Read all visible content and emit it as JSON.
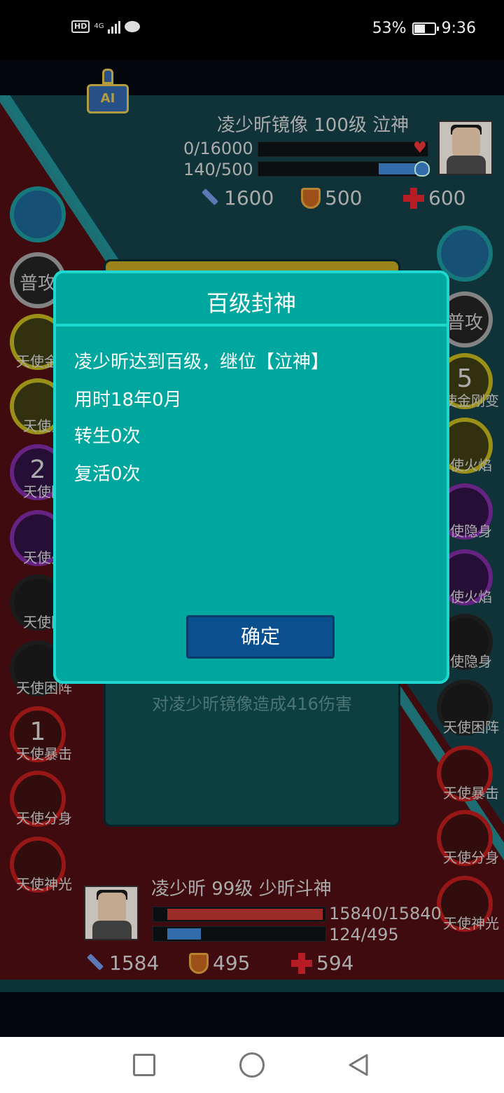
{
  "status_bar": {
    "hd": "HD",
    "network": "4G",
    "battery": "53%",
    "time": "9:36"
  },
  "ai_button": {
    "label": "AI"
  },
  "enemy": {
    "title": "凌少昕镜像 100级 泣神",
    "hp_text": "0/16000",
    "mp_text": "140/500",
    "hp_fraction": 0.0,
    "mp_fraction": 0.28,
    "attack": "1600",
    "defense": "500",
    "health": "600"
  },
  "player": {
    "title": "凌少昕 99级 少昕斗神",
    "hp_text": "15840/15840",
    "mp_text": "124/495",
    "hp_fraction": 1.0,
    "mp_fraction": 0.25,
    "attack": "1584",
    "defense": "495",
    "health": "594"
  },
  "left_skills": {
    "normal": "普攻",
    "s1": "天使金刚",
    "s2": "天使火",
    "s3_count": "2",
    "s3": "天使隐",
    "s4": "天使火",
    "s5": "天使隐",
    "s6": "天使困阵",
    "s7_count": "1",
    "s7": "天使暴击",
    "s8": "天使分身",
    "s9": "天使神光"
  },
  "right_skills": {
    "normal": "普攻",
    "s1_count": "5",
    "s1": "使金刚变",
    "s2": "使火焰",
    "s3": "使隐身",
    "s4": "使火焰",
    "s5": "使隐身",
    "s6": "天使困阵",
    "s7": "天使暴击",
    "s8": "天使分身",
    "s9": "天使神光"
  },
  "battle_log": {
    "line": "对凌少昕镜像造成416伤害"
  },
  "dialog": {
    "title": "百级封神",
    "line1": "凌少昕达到百级，继位【泣神】",
    "line2": "用时18年0月",
    "line3": "转生0次",
    "line4": "复活0次",
    "confirm": "确定"
  }
}
